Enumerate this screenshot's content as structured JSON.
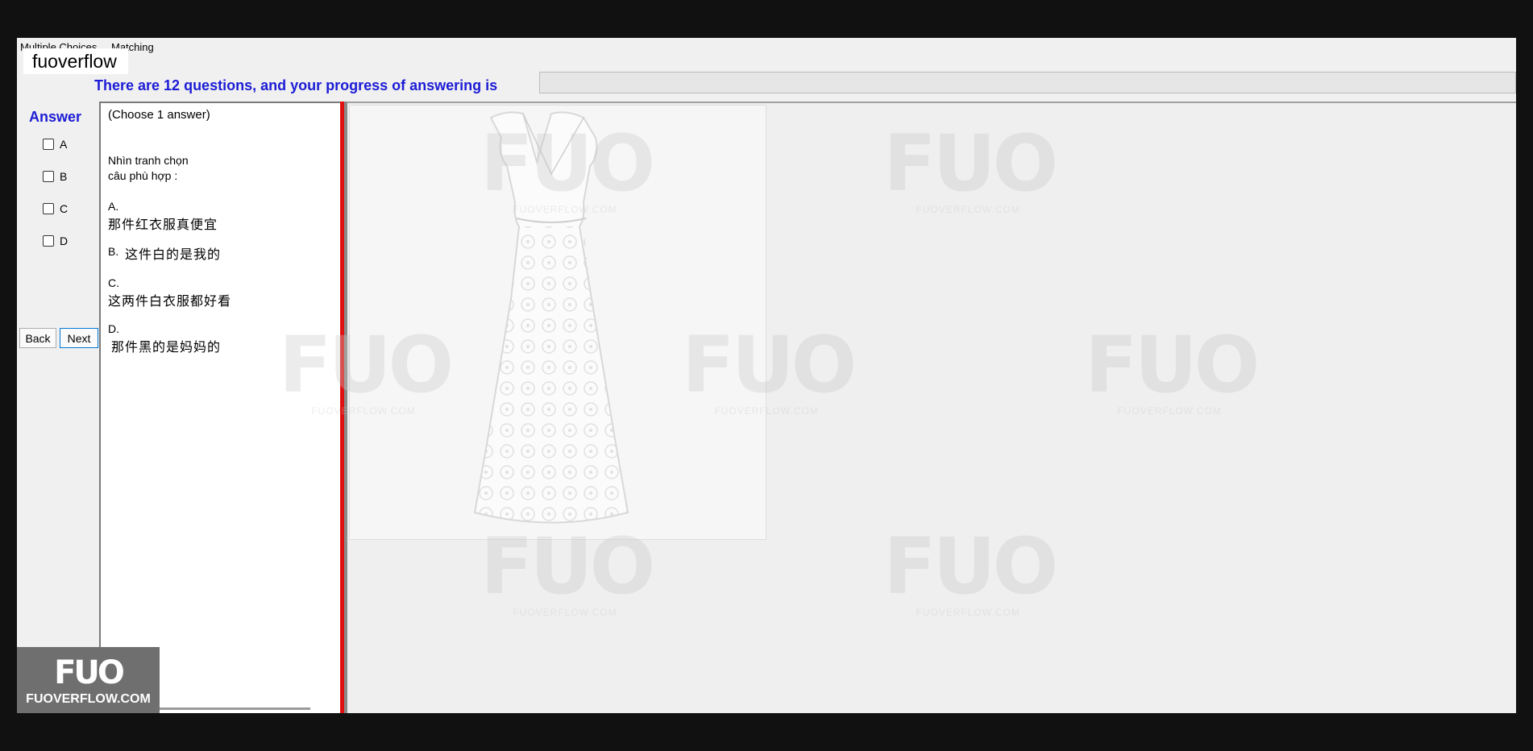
{
  "tabs": [
    "Multiple Choices",
    "Matching"
  ],
  "badge_text": "fuoverflow",
  "progress": {
    "label": "There are 12 questions, and your progress of answering is",
    "fraction": 0
  },
  "answer_panel": {
    "title": "Answer",
    "options": [
      "A",
      "B",
      "C",
      "D"
    ],
    "back_label": "Back",
    "next_label": "Next"
  },
  "question": {
    "instruction": "(Choose 1 answer)",
    "prompt_line1": "Nhìn tranh chọn",
    "prompt_line2": "câu phù hợp :",
    "choices": [
      {
        "letter": "A.",
        "text": "那件红衣服真便宜"
      },
      {
        "letter": "B.",
        "text": "这件白的是我的"
      },
      {
        "letter": "C.",
        "text": "这两件白衣服都好看"
      },
      {
        "letter": "D.",
        "text": "那件黑的是妈妈的"
      }
    ]
  },
  "watermark": {
    "mark": "FUO",
    "url": "FUOVERFLOW.COM"
  },
  "logo": {
    "mark": "FUO",
    "url": "FUOVERFLOW.COM"
  },
  "colors": {
    "accent_blue": "#1c1cd6",
    "divider_red": "#e01010",
    "focus_blue": "#0078d7"
  },
  "icons": [
    "dress-photo"
  ]
}
